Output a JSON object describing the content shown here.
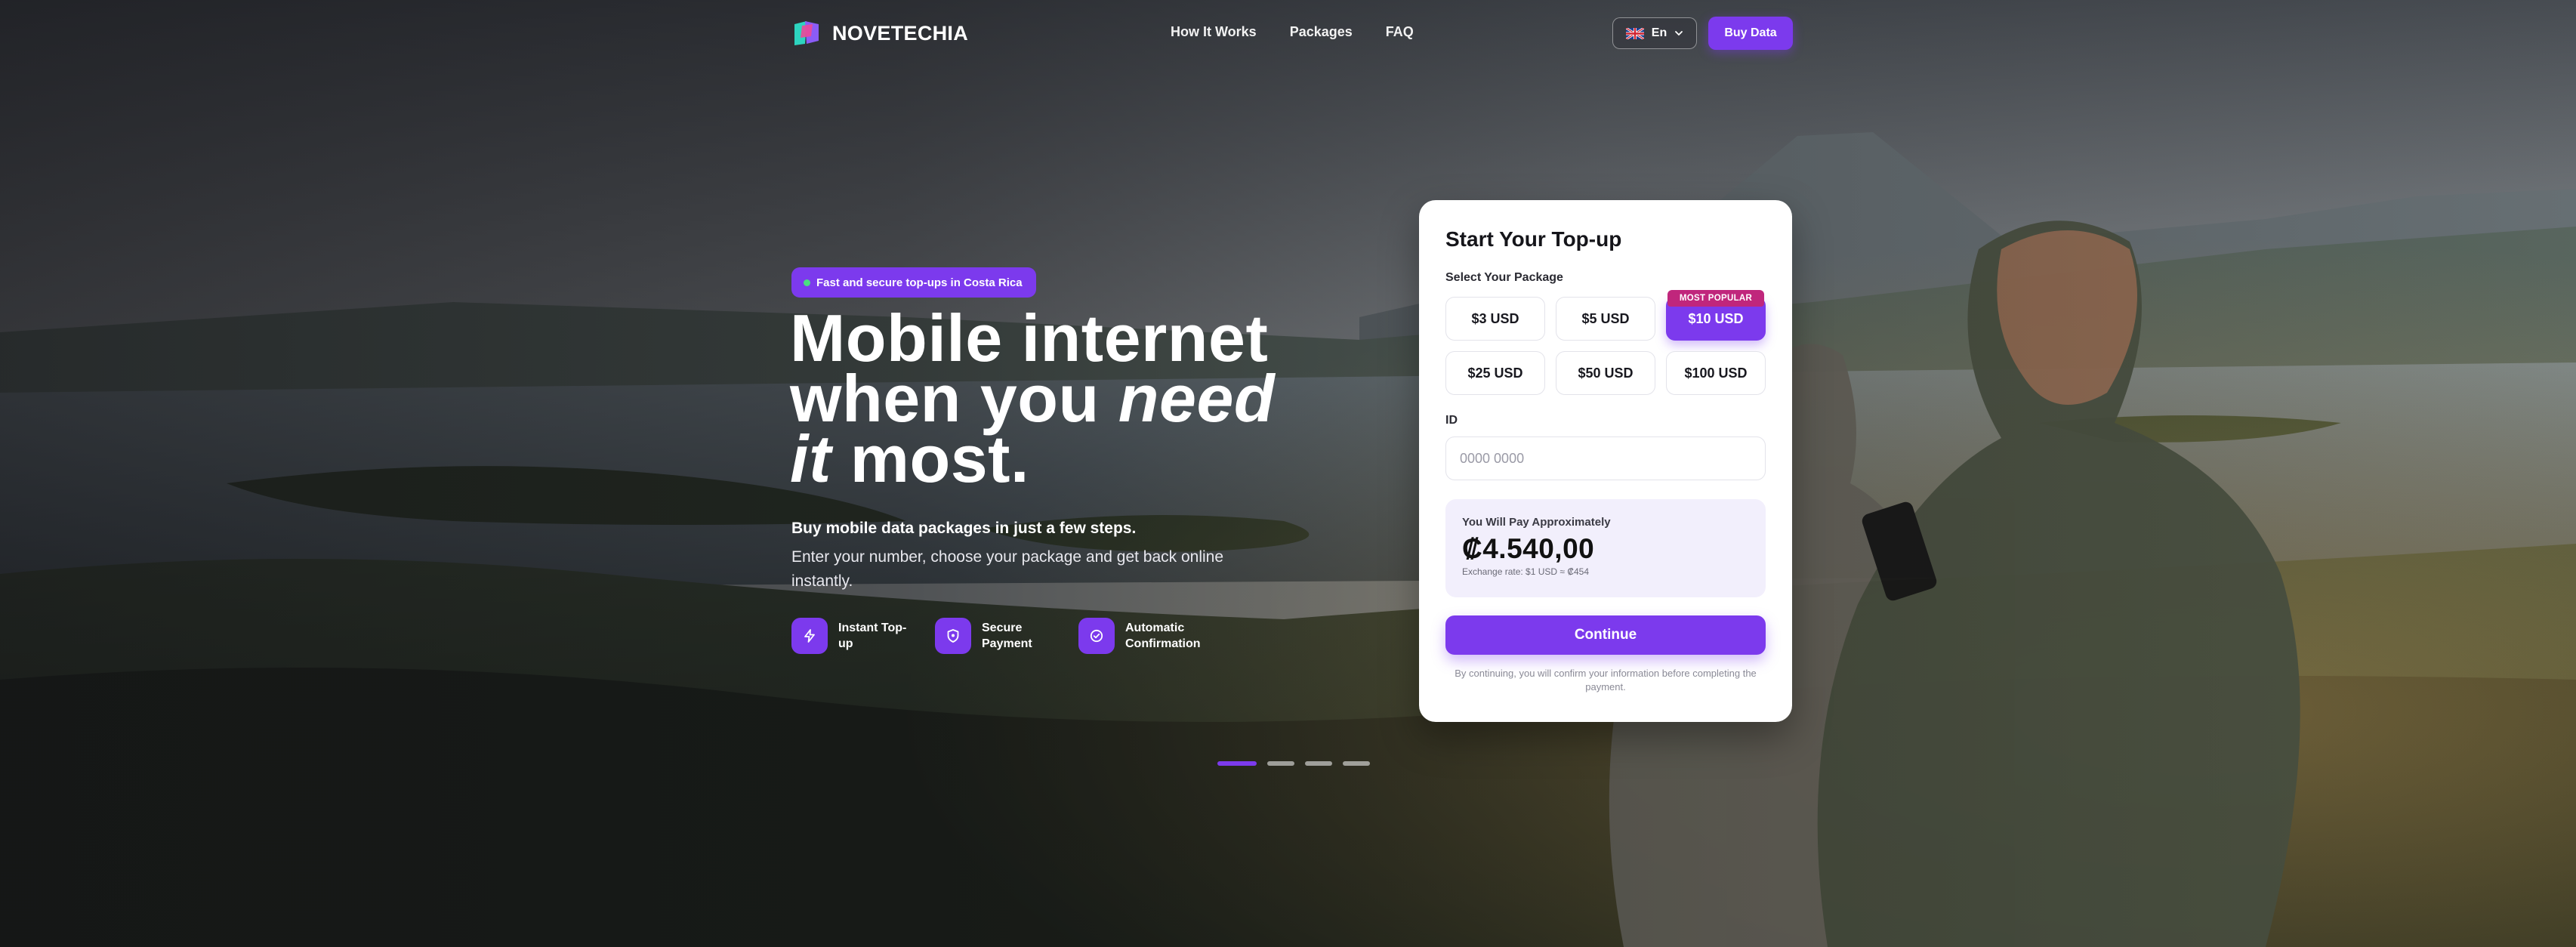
{
  "header": {
    "brand": "NOVETECHIA",
    "nav": [
      {
        "label": "How It Works"
      },
      {
        "label": "Packages"
      },
      {
        "label": "FAQ"
      }
    ],
    "language": {
      "code": "En",
      "flag": "uk-flag-icon"
    },
    "buy_button": "Buy Data"
  },
  "hero": {
    "badge": "Fast and secure top-ups in Costa Rica",
    "headline": {
      "line1": "Mobile internet",
      "line2_pre": "when you ",
      "line2_em": "need",
      "line3_em": "it",
      "line3_post": " most."
    },
    "lead": "Buy mobile data packages in just a few steps.",
    "sub": "Enter your number, choose your package and get back online instantly.",
    "features": [
      {
        "icon": "lightning-icon",
        "label": "Instant Top-up"
      },
      {
        "icon": "shield-icon",
        "label": "Secure Payment"
      },
      {
        "icon": "check-circle-icon",
        "label": "Automatic Confirmation"
      }
    ],
    "carousel": {
      "total": 4,
      "active": 1
    }
  },
  "card": {
    "title": "Start Your Top-up",
    "package_label": "Select Your Package",
    "packages": [
      {
        "label": "$3 USD",
        "selected": false
      },
      {
        "label": "$5 USD",
        "selected": false
      },
      {
        "label": "$10 USD",
        "selected": true,
        "tag": "MOST POPULAR"
      },
      {
        "label": "$25 USD",
        "selected": false
      },
      {
        "label": "$50 USD",
        "selected": false
      },
      {
        "label": "$100 USD",
        "selected": false
      }
    ],
    "id_label": "ID",
    "id_placeholder": "0000 0000",
    "id_value": "",
    "pay_label": "You Will Pay Approximately",
    "pay_amount": "₡4.540,00",
    "exchange_rate": "Exchange rate: $1 USD ≈ ₡454",
    "continue_button": "Continue",
    "disclaimer": "By continuing, you will confirm your information before completing the payment."
  },
  "colors": {
    "accent": "#7c3aed",
    "tag": "#c0267c",
    "status_dot": "#4ade80"
  }
}
